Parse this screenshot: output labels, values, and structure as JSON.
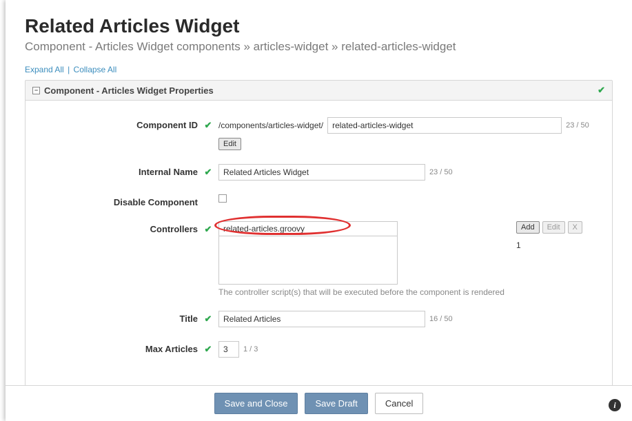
{
  "header": {
    "title": "Related Articles Widget",
    "breadcrumb": "Component - Articles Widget  components » articles-widget » related-articles-widget"
  },
  "links": {
    "expand_all": "Expand All",
    "collapse_all": "Collapse All"
  },
  "panel": {
    "title": "Component - Articles Widget Properties"
  },
  "form": {
    "component_id": {
      "label": "Component ID",
      "prefix": "/components/articles-widget/",
      "value": "related-articles-widget",
      "counter": "23 / 50",
      "edit_btn": "Edit"
    },
    "internal_name": {
      "label": "Internal Name",
      "value": "Related Articles Widget",
      "counter": "23 / 50"
    },
    "disable_component": {
      "label": "Disable Component"
    },
    "controllers": {
      "label": "Controllers",
      "items": [
        "related-articles.groovy"
      ],
      "add_btn": "Add",
      "edit_btn": "Edit",
      "remove_btn": "X",
      "count": "1",
      "help": "The controller script(s) that will be executed before the component is rendered"
    },
    "title_field": {
      "label": "Title",
      "value": "Related Articles",
      "counter": "16 / 50"
    },
    "max_articles": {
      "label": "Max Articles",
      "value": "3",
      "counter": "1 / 3"
    }
  },
  "footer": {
    "save_close": "Save and Close",
    "save_draft": "Save Draft",
    "cancel": "Cancel"
  }
}
